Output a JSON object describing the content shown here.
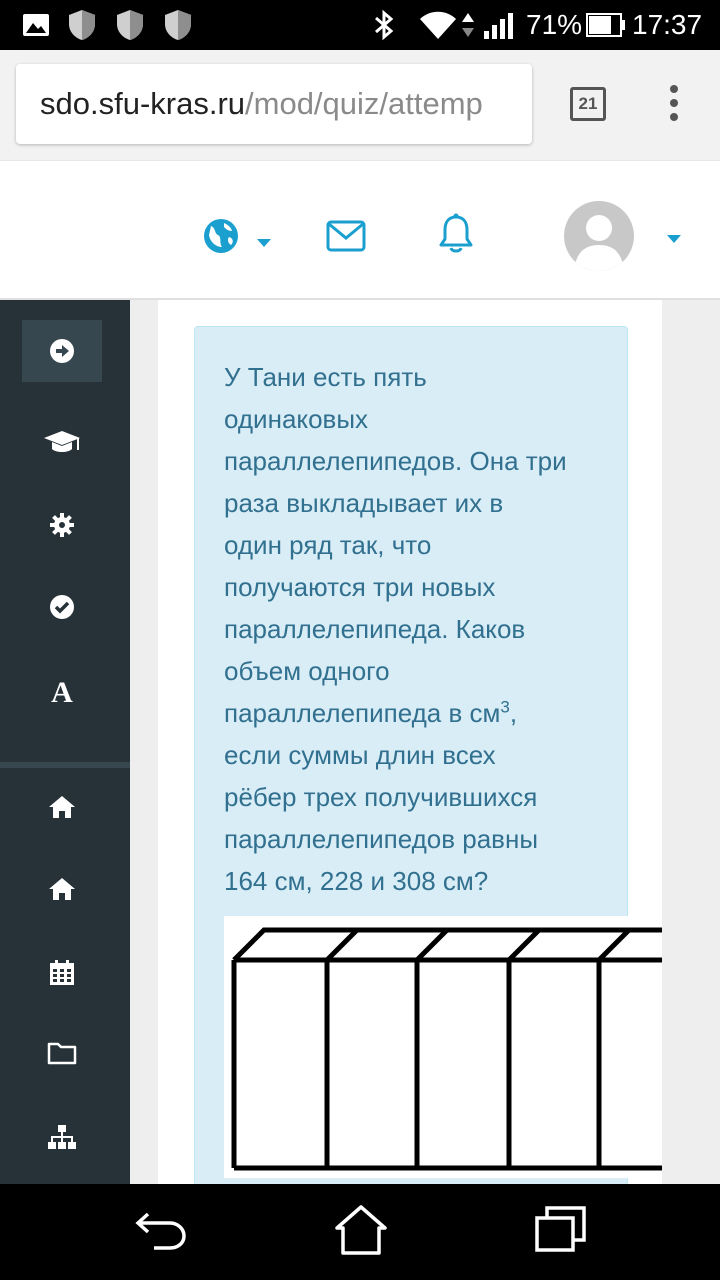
{
  "status_bar": {
    "battery_percent": "71%",
    "time": "17:37"
  },
  "browser": {
    "url_host": "sdo.sfu-kras.ru",
    "url_path": "/mod/quiz/attemp",
    "tab_count": "21"
  },
  "navbar": {
    "icons": [
      "globe-icon",
      "chevron-down-icon",
      "envelope-icon",
      "bell-icon",
      "avatar",
      "chevron-down-icon"
    ]
  },
  "drawer": {
    "items": [
      "arrow-right-icon",
      "graduation-cap-icon",
      "gear-icon",
      "check-circle-icon",
      "font-icon",
      "home-icon",
      "home-icon",
      "calendar-icon",
      "folder-icon",
      "sitemap-icon"
    ]
  },
  "question": {
    "lines": [
      "У Тани есть пять",
      "одинаковых",
      "параллелепипедов. Она три",
      "раза выкладывает их в",
      "один ряд так, что",
      "получаются три новых",
      "параллелепипеда. Каков",
      "объем одного"
    ],
    "line9_main": "параллелепипеда в см",
    "line9_sup": "3",
    "line9_end": ",",
    "lines_after": [
      "если суммы длин всех",
      "рёбер трех получившихся",
      "параллелепипедов равны",
      "164 см, 228 и 308 см?"
    ]
  },
  "colors": {
    "accent": "#1a9fcf",
    "drawer_bg": "#263238",
    "alert_bg": "#d9edf7",
    "alert_text": "#31708f"
  }
}
